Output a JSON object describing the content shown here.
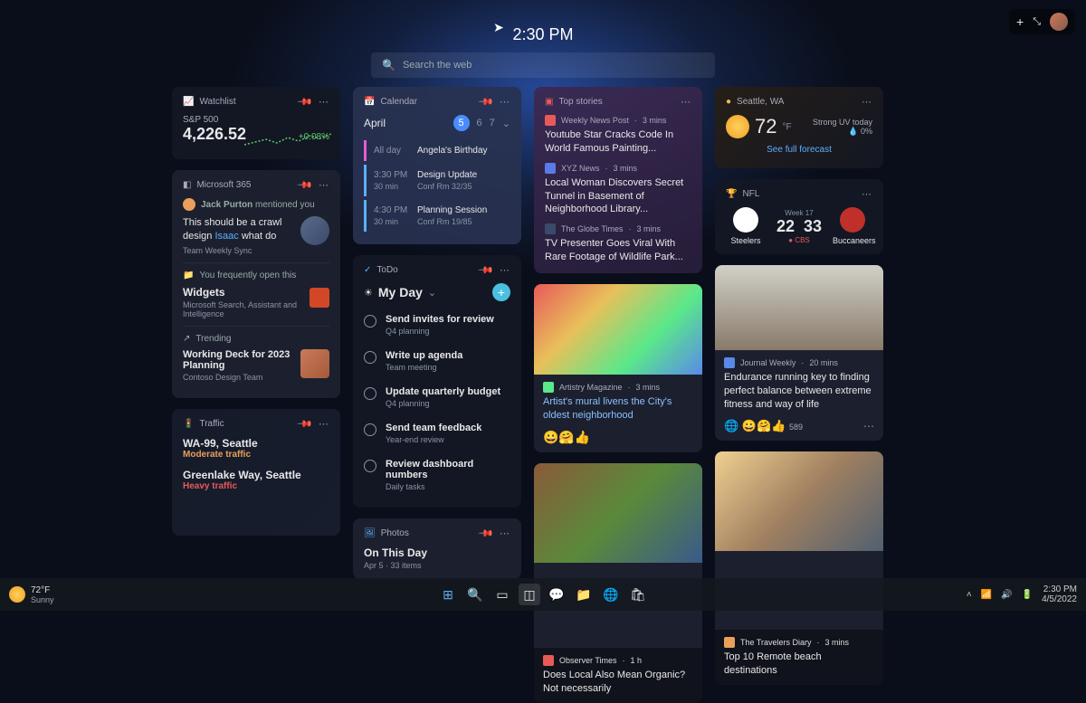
{
  "top": {
    "clock": "2:30 PM",
    "search_placeholder": "Search the web"
  },
  "watchlist": {
    "title": "Watchlist",
    "symbol": "S&P 500",
    "value": "4,226.52",
    "change": "+0.08%"
  },
  "m365": {
    "title": "Microsoft 365",
    "mention_person": "Jack Purton",
    "mention_suffix": " mentioned you",
    "quote1": "This should be a crawl design ",
    "quote_name": "Isaac",
    "quote2": " what do",
    "quote_sub": "Team Weekly Sync",
    "freq_label": "You frequently open this",
    "freq_title": "Widgets",
    "freq_sub": "Microsoft Search, Assistant and Intelligence",
    "trend_label": "Trending",
    "trend_title": "Working Deck for 2023 Planning",
    "trend_sub": "Contoso Design Team"
  },
  "traffic": {
    "title": "Traffic",
    "r1": "WA-99, Seattle",
    "r1s": "Moderate traffic",
    "r2": "Greenlake Way, Seattle",
    "r2s": "Heavy traffic"
  },
  "calendar": {
    "title": "Calendar",
    "month": "April",
    "d1": "5",
    "d2": "6",
    "d3": "7",
    "allday_label": "All day",
    "allday_event": "Angela's Birthday",
    "e1t": "3:30 PM",
    "e1d": "30 min",
    "e1n": "Design Update",
    "e1r": "Conf Rm 32/35",
    "e2t": "4:30 PM",
    "e2d": "30 min",
    "e2n": "Planning Session",
    "e2r": "Conf Rm 19/85"
  },
  "todo": {
    "title": "ToDo",
    "section": "My Day",
    "t1": "Send invites for review",
    "t1s": "Q4 planning",
    "t2": "Write up agenda",
    "t2s": "Team meeting",
    "t3": "Update quarterly budget",
    "t3s": "Q4 planning",
    "t4": "Send team feedback",
    "t4s": "Year-end review",
    "t5": "Review dashboard numbers",
    "t5s": "Daily tasks"
  },
  "photos": {
    "title": "Photos",
    "heading": "On This Day",
    "sub": "Apr 5 · 33 items"
  },
  "topstories": {
    "title": "Top stories",
    "s1src": "Weekly News Post",
    "s1t": "3 mins",
    "s1h": "Youtube Star Cracks Code In World Famous Painting...",
    "s2src": "XYZ News",
    "s2t": "3 mins",
    "s2h": "Local Woman Discovers Secret Tunnel in Basement of Neighborhood Library...",
    "s3src": "The Globe Times",
    "s3t": "3 mins",
    "s3h": "TV Presenter Goes Viral With Rare Footage of Wildlife Park..."
  },
  "news1": {
    "src": "Artistry Magazine",
    "t": "3 mins",
    "h": "Artist's mural livens the City's oldest neighborhood"
  },
  "news2": {
    "src": "Observer Times",
    "t": "1 h",
    "h": "Does Local Also Mean Organic? Not necessarily"
  },
  "weather": {
    "loc": "Seattle, WA",
    "temp": "72",
    "unit": "°F",
    "uv": "Strong UV today",
    "humidity": "0%",
    "link": "See full forecast"
  },
  "nfl": {
    "title": "NFL",
    "week": "Week 17",
    "team1": "Steelers",
    "score1": "22",
    "score2": "33",
    "net": "CBS",
    "team2": "Buccaneers"
  },
  "news3": {
    "src": "Journal Weekly",
    "t": "20 mins",
    "h": "Endurance running key to finding perfect balance between extreme fitness and way of life",
    "count": "589"
  },
  "news4": {
    "src": "The Travelers Diary",
    "t": "3 mins",
    "h": "Top 10 Remote beach destinations"
  },
  "taskbar": {
    "temp": "72°F",
    "cond": "Sunny",
    "time": "2:30 PM",
    "date": "4/5/2022"
  }
}
